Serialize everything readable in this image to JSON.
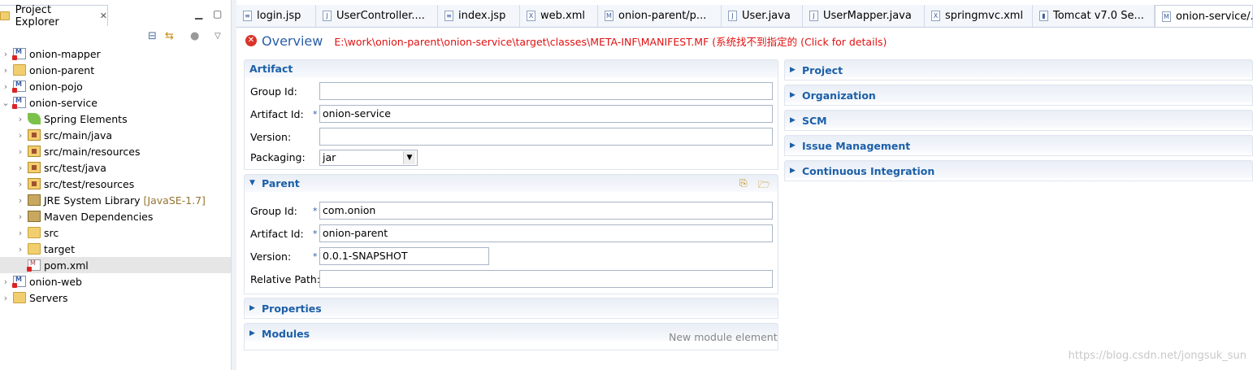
{
  "explorer": {
    "tab_label": "Project Explorer",
    "tab_close": "✕",
    "tree": [
      {
        "label": "onion-mapper",
        "icon": "maven-project-icon",
        "depth": 0,
        "error": true
      },
      {
        "label": "onion-parent",
        "icon": "folder-icon",
        "depth": 0,
        "error": false
      },
      {
        "label": "onion-pojo",
        "icon": "maven-project-icon",
        "depth": 0,
        "error": true
      },
      {
        "label": "onion-service",
        "icon": "maven-project-icon",
        "depth": 0,
        "error": true,
        "expanded": true
      },
      {
        "label": "Spring Elements",
        "icon": "spring-leaf-icon",
        "depth": 1
      },
      {
        "label": "src/main/java",
        "icon": "source-folder-icon",
        "depth": 1
      },
      {
        "label": "src/main/resources",
        "icon": "source-folder-icon",
        "depth": 1
      },
      {
        "label": "src/test/java",
        "icon": "source-folder-icon",
        "depth": 1
      },
      {
        "label": "src/test/resources",
        "icon": "source-folder-icon",
        "depth": 1
      },
      {
        "label": "JRE System Library",
        "suffix": "[JavaSE-1.7]",
        "icon": "library-icon",
        "depth": 1
      },
      {
        "label": "Maven Dependencies",
        "icon": "library-icon",
        "depth": 1
      },
      {
        "label": "src",
        "icon": "folder-icon",
        "depth": 1
      },
      {
        "label": "target",
        "icon": "folder-icon",
        "depth": 1
      },
      {
        "label": "pom.xml",
        "icon": "xml-file-icon",
        "depth": 1,
        "selected": true,
        "error": true
      },
      {
        "label": "onion-web",
        "icon": "maven-project-icon",
        "depth": 0,
        "error": true
      },
      {
        "label": "Servers",
        "icon": "folder-icon",
        "depth": 0
      }
    ]
  },
  "editor_tabs": [
    {
      "label": "login.jsp",
      "icon": "jsp-file-icon"
    },
    {
      "label": "UserController....",
      "icon": "java-file-icon"
    },
    {
      "label": "index.jsp",
      "icon": "jsp-file-icon"
    },
    {
      "label": "web.xml",
      "icon": "xml-file-icon"
    },
    {
      "label": "onion-parent/p...",
      "icon": "maven-pom-icon"
    },
    {
      "label": "User.java",
      "icon": "java-file-icon"
    },
    {
      "label": "UserMapper.java",
      "icon": "java-file-icon"
    },
    {
      "label": "springmvc.xml",
      "icon": "xml-file-icon"
    },
    {
      "label": "Tomcat v7.0 Se...",
      "icon": "server-icon"
    },
    {
      "label": "onion-service/...",
      "icon": "maven-pom-icon",
      "active": true
    }
  ],
  "header": {
    "title": "Overview",
    "error_message": "E:\\work\\onion-parent\\onion-service\\target\\classes\\META-INF\\MANIFEST.MF (系统找不到指定的 (Click for details)"
  },
  "artifact": {
    "title": "Artifact",
    "group_id_label": "Group Id:",
    "group_id": "",
    "artifact_id_label": "Artifact Id:",
    "artifact_id": "onion-service",
    "version_label": "Version:",
    "version": "",
    "packaging_label": "Packaging:",
    "packaging": "jar"
  },
  "parent": {
    "title": "Parent",
    "group_id_label": "Group Id:",
    "group_id": "com.onion",
    "artifact_id_label": "Artifact Id:",
    "artifact_id": "onion-parent",
    "version_label": "Version:",
    "version": "0.0.1-SNAPSHOT",
    "relative_path_label": "Relative Path:",
    "relative_path": ""
  },
  "properties": {
    "title": "Properties"
  },
  "modules": {
    "title": "Modules",
    "hint": "New module element"
  },
  "right_sections": [
    "Project",
    "Organization",
    "SCM",
    "Issue Management",
    "Continuous Integration"
  ],
  "watermark": "https://blog.csdn.net/jongsuk_sun"
}
